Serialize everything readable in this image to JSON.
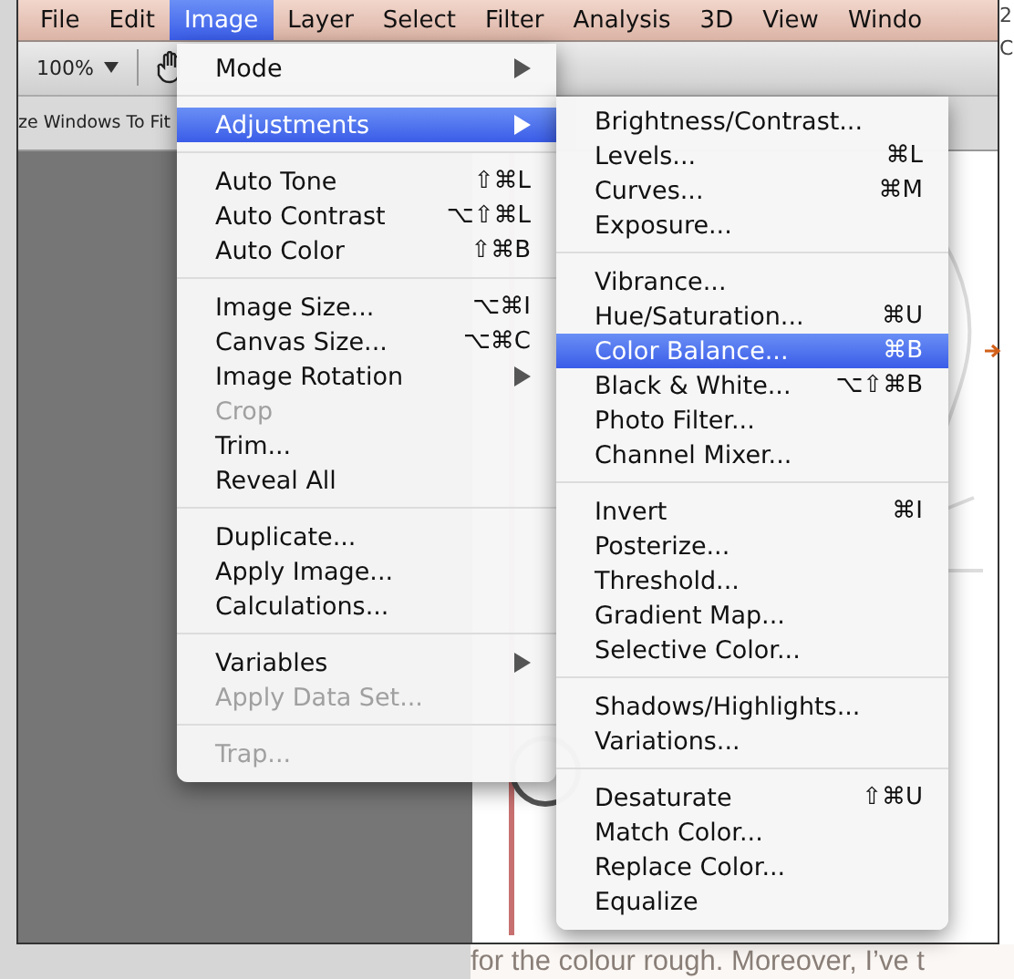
{
  "menubar": [
    {
      "label": "File",
      "selected": false
    },
    {
      "label": "Edit",
      "selected": false
    },
    {
      "label": "Image",
      "selected": true
    },
    {
      "label": "Layer",
      "selected": false
    },
    {
      "label": "Select",
      "selected": false
    },
    {
      "label": "Filter",
      "selected": false
    },
    {
      "label": "Analysis",
      "selected": false
    },
    {
      "label": "3D",
      "selected": false
    },
    {
      "label": "View",
      "selected": false
    },
    {
      "label": "Windo",
      "selected": false
    }
  ],
  "toolbar": {
    "zoom": "100%"
  },
  "options_bar": {
    "label": "ze Windows To Fit"
  },
  "image_menu": {
    "groups": [
      [
        {
          "label": "Mode",
          "submenu": true,
          "disabled": false,
          "selected": false
        }
      ],
      [
        {
          "label": "Adjustments",
          "submenu": true,
          "disabled": false,
          "selected": true
        }
      ],
      [
        {
          "label": "Auto Tone",
          "shortcut": "⇧⌘L",
          "submenu": false,
          "disabled": false,
          "selected": false
        },
        {
          "label": "Auto Contrast",
          "shortcut": "⌥⇧⌘L",
          "submenu": false,
          "disabled": false,
          "selected": false
        },
        {
          "label": "Auto Color",
          "shortcut": "⇧⌘B",
          "submenu": false,
          "disabled": false,
          "selected": false
        }
      ],
      [
        {
          "label": "Image Size...",
          "shortcut": "⌥⌘I",
          "submenu": false,
          "disabled": false,
          "selected": false
        },
        {
          "label": "Canvas Size...",
          "shortcut": "⌥⌘C",
          "submenu": false,
          "disabled": false,
          "selected": false
        },
        {
          "label": "Image Rotation",
          "submenu": true,
          "disabled": false,
          "selected": false
        },
        {
          "label": "Crop",
          "submenu": false,
          "disabled": true,
          "selected": false
        },
        {
          "label": "Trim...",
          "submenu": false,
          "disabled": false,
          "selected": false
        },
        {
          "label": "Reveal All",
          "submenu": false,
          "disabled": false,
          "selected": false
        }
      ],
      [
        {
          "label": "Duplicate...",
          "submenu": false,
          "disabled": false,
          "selected": false
        },
        {
          "label": "Apply Image...",
          "submenu": false,
          "disabled": false,
          "selected": false
        },
        {
          "label": "Calculations...",
          "submenu": false,
          "disabled": false,
          "selected": false
        }
      ],
      [
        {
          "label": "Variables",
          "submenu": true,
          "disabled": false,
          "selected": false
        },
        {
          "label": "Apply Data Set...",
          "submenu": false,
          "disabled": true,
          "selected": false
        }
      ],
      [
        {
          "label": "Trap...",
          "submenu": false,
          "disabled": true,
          "selected": false
        }
      ]
    ]
  },
  "adjustments_menu": {
    "groups": [
      [
        {
          "label": "Brightness/Contrast...",
          "selected": false
        },
        {
          "label": "Levels...",
          "shortcut": "⌘L",
          "selected": false
        },
        {
          "label": "Curves...",
          "shortcut": "⌘M",
          "selected": false
        },
        {
          "label": "Exposure...",
          "selected": false
        }
      ],
      [
        {
          "label": "Vibrance...",
          "selected": false
        },
        {
          "label": "Hue/Saturation...",
          "shortcut": "⌘U",
          "selected": false
        },
        {
          "label": "Color Balance...",
          "shortcut": "⌘B",
          "selected": true
        },
        {
          "label": "Black & White...",
          "shortcut": "⌥⇧⌘B",
          "selected": false
        },
        {
          "label": "Photo Filter...",
          "selected": false
        },
        {
          "label": "Channel Mixer...",
          "selected": false
        }
      ],
      [
        {
          "label": "Invert",
          "shortcut": "⌘I",
          "selected": false
        },
        {
          "label": "Posterize...",
          "selected": false
        },
        {
          "label": "Threshold...",
          "selected": false
        },
        {
          "label": "Gradient Map...",
          "selected": false
        },
        {
          "label": "Selective Color...",
          "selected": false
        }
      ],
      [
        {
          "label": "Shadows/Highlights...",
          "selected": false
        },
        {
          "label": "Variations...",
          "selected": false
        }
      ],
      [
        {
          "label": "Desaturate",
          "shortcut": "⇧⌘U",
          "selected": false
        },
        {
          "label": "Match Color...",
          "selected": false
        },
        {
          "label": "Replace Color...",
          "selected": false
        },
        {
          "label": "Equalize",
          "selected": false
        }
      ]
    ]
  },
  "page_side_text": [
    "2",
    "C"
  ],
  "page_caption": "for the colour rough. Moreover, I’ve t"
}
